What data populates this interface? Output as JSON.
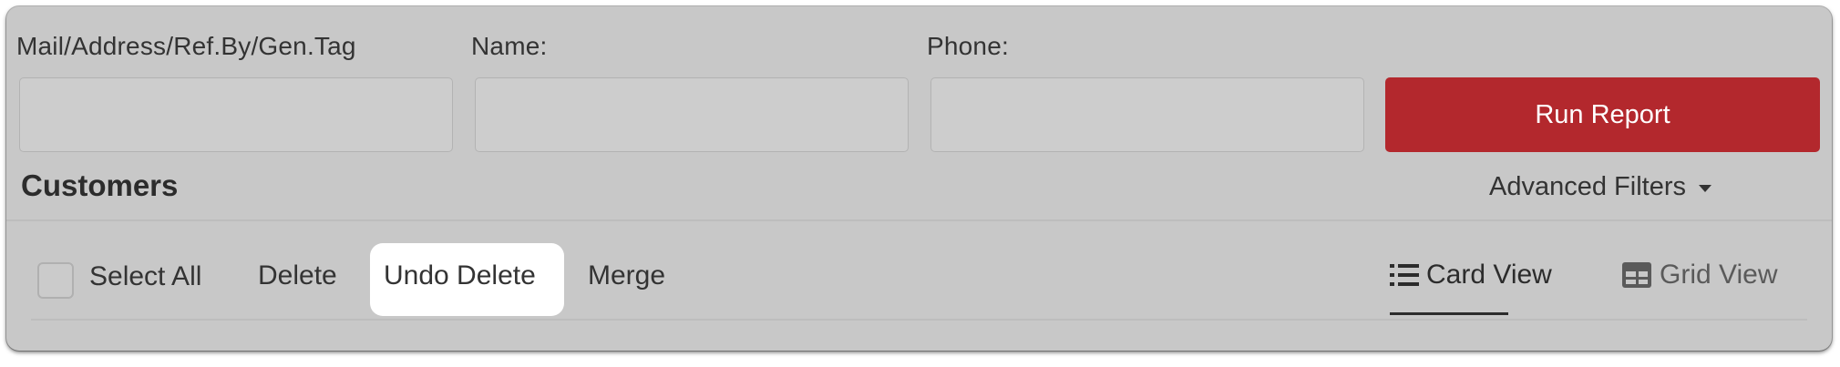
{
  "filters": {
    "mail_label": "Mail/Address/Ref.By/Gen.Tag",
    "mail_value": "",
    "name_label": "Name:",
    "name_value": "",
    "phone_label": "Phone:",
    "phone_value": "",
    "run_label": "Run Report"
  },
  "section": {
    "title": "Customers",
    "advanced_filters_label": "Advanced Filters"
  },
  "toolbar": {
    "select_all_label": "Select All",
    "delete_label": "Delete",
    "undo_delete_label": "Undo Delete",
    "merge_label": "Merge"
  },
  "views": {
    "card_label": "Card View",
    "grid_label": "Grid View",
    "active": "Card View"
  },
  "colors": {
    "panel_bg": "#c8c8c8",
    "accent_red": "#b3282d",
    "text_dark": "#333333",
    "text_muted": "#5a5a5a"
  },
  "icons": {
    "card_view": "list-icon",
    "grid_view": "grid-icon",
    "advanced_filters": "caret-down-icon"
  }
}
